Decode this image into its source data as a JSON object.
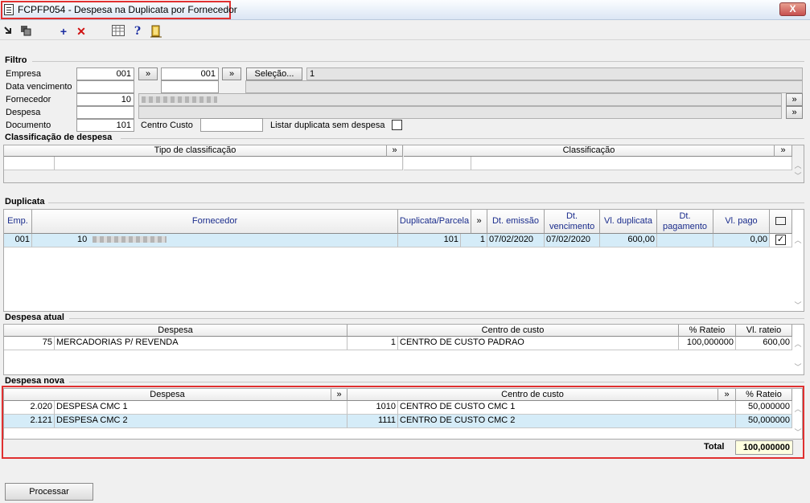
{
  "window": {
    "title": "FCPFP054 - Despesa na Duplicata por Fornecedor",
    "close_glyph": "X"
  },
  "toolbar": {
    "icons": [
      "export-icon",
      "copy-icon",
      "add-icon",
      "delete-icon",
      "grid-icon",
      "help-icon",
      "exit-icon"
    ],
    "add_glyph": "+",
    "delete_glyph": "✕",
    "help_glyph": "?"
  },
  "filtro": {
    "label": "Filtro",
    "empresa_label": "Empresa",
    "empresa_from": "001",
    "empresa_to": "001",
    "selecao_label": "Seleção...",
    "selecao_value": "1",
    "data_vencimento_label": "Data vencimento",
    "fornecedor_label": "Fornecedor",
    "fornecedor_value": "10",
    "despesa_label": "Despesa",
    "documento_label": "Documento",
    "documento_value": "101",
    "centro_custo_label": "Centro Custo",
    "listar_label": "Listar duplicata sem despesa",
    "more_glyph": "»"
  },
  "classificacao": {
    "label": "Classificação de despesa",
    "col_tipo": "Tipo de classificação",
    "col_classificacao": "Classificação"
  },
  "duplicata": {
    "label": "Duplicata",
    "columns": [
      "Emp.",
      "Fornecedor",
      "Duplicata/Parcela",
      "Dt. emissão",
      "Dt. vencimento",
      "Vl. duplicata",
      "Dt. pagamento",
      "Vl. pago"
    ],
    "rows": [
      {
        "emp": "001",
        "fornecedor": "10",
        "duplicata": "101",
        "parcela": "1",
        "dt_emissao": "07/02/2020",
        "dt_vencimento": "07/02/2020",
        "vl_duplicata": "600,00",
        "dt_pagamento": "",
        "vl_pago": "0,00",
        "checked": true
      }
    ]
  },
  "despesa_atual": {
    "label": "Despesa atual",
    "columns": [
      "Despesa",
      "Centro de custo",
      "% Rateio",
      "Vl. rateio"
    ],
    "rows": [
      {
        "despesa_cod": "75",
        "despesa_desc": "MERCADORIAS P/ REVENDA",
        "cc_cod": "1",
        "cc_desc": "CENTRO DE CUSTO PADRAO",
        "rateio": "100,000000",
        "vl_rateio": "600,00"
      }
    ]
  },
  "despesa_nova": {
    "label": "Despesa nova",
    "columns": [
      "Despesa",
      "Centro de custo",
      "% Rateio"
    ],
    "rows": [
      {
        "despesa_cod": "2.020",
        "despesa_desc": "DESPESA CMC 1",
        "cc_cod": "1010",
        "cc_desc": "CENTRO DE CUSTO CMC 1",
        "rateio": "50,000000"
      },
      {
        "despesa_cod": "2.121",
        "despesa_desc": "DESPESA CMC 2",
        "cc_cod": "1111",
        "cc_desc": "CENTRO DE CUSTO CMC 2",
        "rateio": "50,000000"
      }
    ],
    "total_label": "Total",
    "total_value": "100,000000"
  },
  "processar_label": "Processar"
}
